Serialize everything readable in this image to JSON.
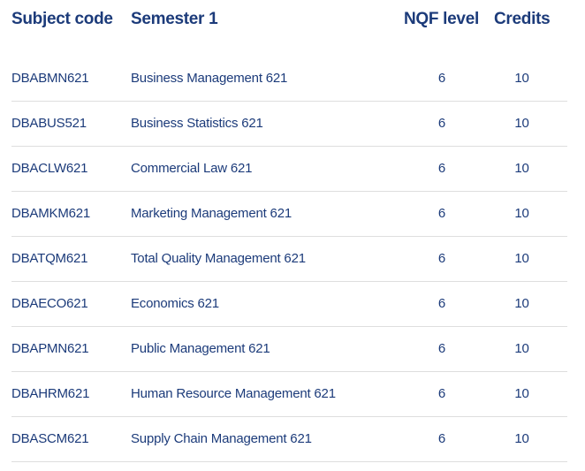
{
  "table": {
    "headers": {
      "code": "Subject code",
      "name": "Semester 1",
      "nqf": "NQF level",
      "credits": "Credits"
    },
    "rows": [
      {
        "code": "DBABMN621",
        "name": "Business Management 621",
        "nqf": "6",
        "credits": "10"
      },
      {
        "code": "DBABUS521",
        "name": "Business Statistics 621",
        "nqf": "6",
        "credits": "10"
      },
      {
        "code": "DBACLW621",
        "name": "Commercial Law 621",
        "nqf": "6",
        "credits": "10"
      },
      {
        "code": "DBAMKM621",
        "name": "Marketing Management 621",
        "nqf": "6",
        "credits": "10"
      },
      {
        "code": "DBATQM621",
        "name": "Total Quality Management 621",
        "nqf": "6",
        "credits": "10"
      },
      {
        "code": "DBAECO621",
        "name": "Economics 621",
        "nqf": "6",
        "credits": "10"
      },
      {
        "code": "DBAPMN621",
        "name": "Public Management 621",
        "nqf": "6",
        "credits": "10"
      },
      {
        "code": "DBAHRM621",
        "name": "Human Resource Management 621",
        "nqf": "6",
        "credits": "10"
      },
      {
        "code": "DBASCM621",
        "name": "Supply Chain Management 621",
        "nqf": "6",
        "credits": "10"
      }
    ]
  }
}
